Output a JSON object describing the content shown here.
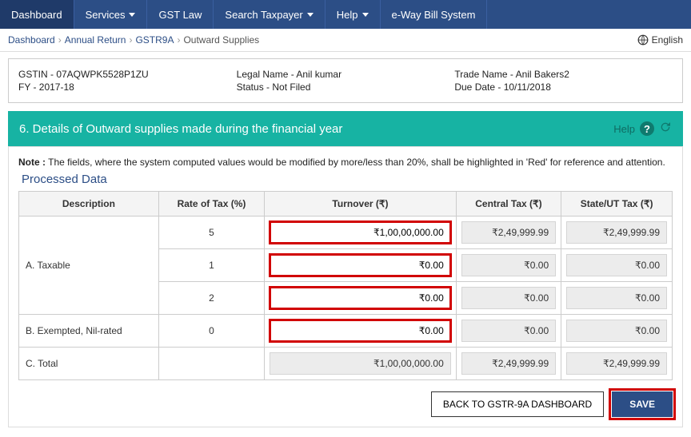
{
  "nav": {
    "items": [
      {
        "label": "Dashboard",
        "caret": false,
        "active": true
      },
      {
        "label": "Services",
        "caret": true,
        "active": false
      },
      {
        "label": "GST Law",
        "caret": false,
        "active": false
      },
      {
        "label": "Search Taxpayer",
        "caret": true,
        "active": false
      },
      {
        "label": "Help",
        "caret": true,
        "active": false
      },
      {
        "label": "e-Way Bill System",
        "caret": false,
        "active": false
      }
    ]
  },
  "breadcrumb": {
    "items": [
      "Dashboard",
      "Annual Return",
      "GSTR9A"
    ],
    "current": "Outward Supplies",
    "language": "English"
  },
  "taxpayer": {
    "gstin_label": "GSTIN - 07AQWPK5528P1ZU",
    "fy_label": "FY - 2017-18",
    "legal": "Legal Name - Anil kumar",
    "status": "Status - Not Filed",
    "trade": "Trade Name - Anil Bakers2",
    "due": "Due Date - 10/11/2018"
  },
  "section": {
    "title": "6. Details of Outward supplies made during the financial year",
    "help": "Help"
  },
  "note": {
    "prefix": "Note :",
    "body": " The fields, where the system computed values would be modified by more/less than 20%, shall be highlighted in 'Red' for reference and attention."
  },
  "table": {
    "processed": "Processed Data",
    "headers": {
      "desc": "Description",
      "rate": "Rate of Tax (%)",
      "turnover": "Turnover (₹)",
      "ctax": "Central Tax (₹)",
      "stax": "State/UT Tax (₹)"
    },
    "rows": [
      {
        "desc": "",
        "rate": "5",
        "turnover": "₹1,00,00,000.00",
        "ctax": "₹2,49,999.99",
        "stax": "₹2,49,999.99",
        "group": "A. Taxable",
        "editable": true
      },
      {
        "desc": "A. Taxable",
        "rate": "1",
        "turnover": "₹0.00",
        "ctax": "₹0.00",
        "stax": "₹0.00",
        "editable": true
      },
      {
        "desc": "",
        "rate": "2",
        "turnover": "₹0.00",
        "ctax": "₹0.00",
        "stax": "₹0.00",
        "editable": true
      },
      {
        "desc": "B. Exempted, Nil-rated",
        "rate": "0",
        "turnover": "₹0.00",
        "ctax": "₹0.00",
        "stax": "₹0.00",
        "editable": true
      },
      {
        "desc": "C. Total",
        "rate": "",
        "turnover": "₹1,00,00,000.00",
        "ctax": "₹2,49,999.99",
        "stax": "₹2,49,999.99",
        "editable": false
      }
    ]
  },
  "actions": {
    "back": "BACK TO GSTR-9A DASHBOARD",
    "save": "SAVE"
  }
}
